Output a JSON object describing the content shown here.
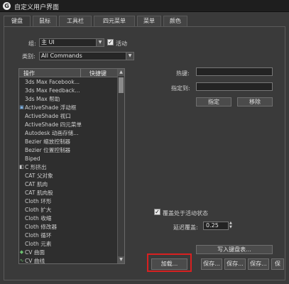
{
  "window": {
    "title": "自定义用户界面",
    "app_icon": "G"
  },
  "tabs": [
    "键盘",
    "鼠标",
    "工具栏",
    "四元菜单",
    "菜单",
    "颜色"
  ],
  "keyboard": {
    "group_label": "组:",
    "group_value": "主 UI",
    "active_label": "活动",
    "active_checked": true,
    "category_label": "类别:",
    "category_value": "All Commands"
  },
  "list": {
    "col_action": "操作",
    "col_shortcut": "快捷键",
    "rows": [
      {
        "icon": "",
        "label": "3ds Max Facebook..."
      },
      {
        "icon": "",
        "label": "3ds Max Feedback..."
      },
      {
        "icon": "",
        "label": "3ds Max 帮助"
      },
      {
        "icon": "activeshade-icon",
        "label": "ActiveShade 浮动框"
      },
      {
        "icon": "",
        "label": "ActiveShade 视口"
      },
      {
        "icon": "",
        "label": "ActiveShade 四元菜单"
      },
      {
        "icon": "",
        "label": "Autodesk 动画存储..."
      },
      {
        "icon": "",
        "label": "Bezier 缩放控制器"
      },
      {
        "icon": "",
        "label": "Bezier 位置控制器"
      },
      {
        "icon": "",
        "label": "Biped"
      },
      {
        "icon": "extrude-icon",
        "label": "C 形挤出"
      },
      {
        "icon": "",
        "label": "CAT 父对象"
      },
      {
        "icon": "",
        "label": "CAT 肌肉"
      },
      {
        "icon": "",
        "label": "CAT 肌肉股"
      },
      {
        "icon": "",
        "label": "Cloth 环形"
      },
      {
        "icon": "",
        "label": "Cloth 扩大"
      },
      {
        "icon": "",
        "label": "Cloth 收缩"
      },
      {
        "icon": "",
        "label": "Cloth 修改器"
      },
      {
        "icon": "",
        "label": "Cloth 循环"
      },
      {
        "icon": "",
        "label": "Cloth 元素"
      },
      {
        "icon": "cv-surface-icon",
        "label": "CV 曲面"
      },
      {
        "icon": "cv-curve-icon",
        "label": "CV 曲线"
      }
    ]
  },
  "hotkey_label": "热键:",
  "assigned_label": "指定到:",
  "assign_button": "指定",
  "remove_button": "移除",
  "overwrite_label": "覆盖处于活动状态",
  "overwrite_checked": true,
  "delay_label": "延迟覆盖:",
  "delay_value": "0.25",
  "write_keyboard_button": "写入键盘表...",
  "load_button": "加载...",
  "save_buttons": [
    "保存...",
    "保存...",
    "保存...",
    "保"
  ]
}
